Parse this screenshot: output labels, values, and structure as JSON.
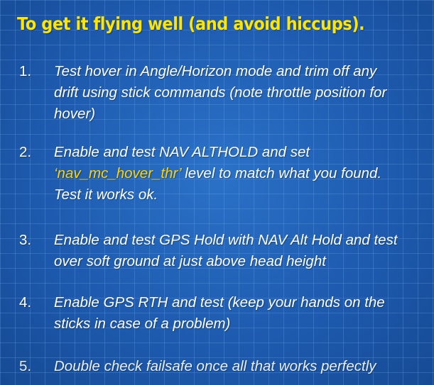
{
  "slide": {
    "title": "To get it flying well (and avoid hiccups).",
    "steps": [
      {
        "number": "1.",
        "lines": [
          "Test hover in Angle/Horizon mode and trim off any",
          "drift using stick commands (note throttle position for",
          "hover)"
        ]
      },
      {
        "number": "2.",
        "line1": "Enable and test NAV ALTHOLD and set",
        "line2_param": "‘nav_mc_hover_thr’",
        "line2_rest": " level to match what you found.",
        "line3": "Test it works ok."
      },
      {
        "number": "3.",
        "lines": [
          "Enable and test GPS Hold with NAV Alt Hold and test",
          "over soft ground at just above head height"
        ]
      },
      {
        "number": "4.",
        "lines": [
          "Enable GPS RTH and test (keep your hands on the",
          "sticks in case of a problem)"
        ]
      },
      {
        "number": "5.",
        "lines": [
          "Double check failsafe once all that works perfectly"
        ]
      }
    ]
  }
}
